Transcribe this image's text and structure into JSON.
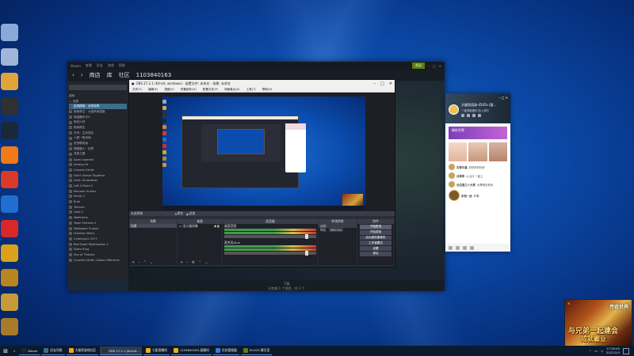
{
  "desktop": {
    "icons": [
      {
        "name": "recycle-bin-icon",
        "color": "#8aa9d8"
      },
      {
        "name": "this-pc-icon",
        "color": "#9fb6d8"
      },
      {
        "name": "chrome-icon",
        "color": "#e0a43a"
      },
      {
        "name": "obs-icon",
        "color": "#303030"
      },
      {
        "name": "steam-icon",
        "color": "#1b2838"
      },
      {
        "name": "app-orange-icon",
        "color": "#f07a1a"
      },
      {
        "name": "app-red-icon",
        "color": "#d93a2a"
      },
      {
        "name": "app-blue-icon",
        "color": "#1f6fd1"
      },
      {
        "name": "netease-music-icon",
        "color": "#d82828"
      },
      {
        "name": "app-yellow-icon",
        "color": "#d9a21a"
      },
      {
        "name": "game-app-icon",
        "color": "#b8861c"
      },
      {
        "name": "game-app-2-icon",
        "color": "#c79a3a"
      },
      {
        "name": "game-app-3-icon",
        "color": "#a87a2a"
      }
    ]
  },
  "steam": {
    "top_menu": [
      "Steam",
      "查看",
      "好友",
      "游戏",
      "帮助"
    ],
    "top_right_btn": "邀请",
    "nav": [
      "商店",
      "库",
      "社区"
    ],
    "user_id": "1103840163",
    "sidebar_header": "游戏",
    "sidebar_section": "— 全部",
    "sidebar_items": [
      "反恐精英：全球攻势",
      "绝地求生：大逃杀竞技版",
      "侠盗猎车手V",
      "彩虹六号",
      "绝地求生",
      "方舟：生存进化",
      "人类一败涂地",
      "饥荒联机版",
      "怪物猎人：世界",
      "流放之路",
      "Apex Legends",
      "Among Us",
      "Counter-Strike",
      "Don't Starve Together",
      "Hunt: Showdown",
      "Left 4 Dead 2",
      "Monster Hunter",
      "Portal 2",
      "Rust",
      "Terraria",
      "Dota 2",
      "Warframe",
      "Team Fortress 2",
      "Wallpaper Engine",
      "Stardew Valley",
      "Cyberpunk 2077",
      "Red Dead Redemption 2",
      "Elden Ring",
      "Sea of Thieves",
      "Counter-Strike: Global Offensive"
    ],
    "bottom_label": "下载",
    "bottom_sub": "已完成 1 个项目，共 1 个"
  },
  "obs": {
    "title": "OBS 27.2.1 (64-bit, windows) - 配置文件: 未命名 - 场景: 未命名",
    "menu": [
      "文件(F)",
      "编辑(E)",
      "视图(V)",
      "停靠部件(D)",
      "配置文件(P)",
      "场景集合(S)",
      "工具(T)",
      "帮助(H)"
    ],
    "no_source_label": "未选择源",
    "props_label": "属性",
    "filters_label": "滤镜",
    "docks": {
      "scenes": "场景",
      "sources": "来源",
      "mixer": "混音器",
      "transitions": "转场特效",
      "controls": "控件"
    },
    "scene_item": "场景",
    "source_item": "显示器采集",
    "mixer_tracks": [
      "桌面音频",
      "麦克风/Aux"
    ],
    "transition_type": "淡出",
    "transition_duration_label": "时长",
    "transition_duration": "300 ms",
    "controls": [
      "开始推流",
      "开始录制",
      "启动虚拟摄像机",
      "工作室模式",
      "设置",
      "退出"
    ]
  },
  "qq": {
    "title": "大猫哥语录-4545s (客...",
    "subtitle": "一键领取福利 加入我们",
    "banner": "精彩世界",
    "messages": [
      {
        "user": "杰哥牛逼",
        "text": "好好好好好好"
      },
      {
        "user": "兵哥哥",
        "text": "火山口 一起上"
      },
      {
        "user": "云边第三人大哥",
        "text": "大哥明天来玩"
      },
      {
        "user": "永恒一战",
        "text": "好嘞"
      }
    ]
  },
  "game_ad": {
    "logo": "传奇世界",
    "line1": "与兄弟一起建会",
    "line2": "成就霸业",
    "close": "×"
  },
  "taskbar": {
    "items": [
      {
        "label": "Steam",
        "color": "#1b2838",
        "active": false
      },
      {
        "label": "好友列表",
        "color": "#3d6c8d",
        "active": false
      },
      {
        "label": "大猫哥游戏社区",
        "color": "#f2a51a",
        "active": false
      },
      {
        "label": "OBS 27.2.1 (64-bit...",
        "color": "#303030",
        "active": true
      },
      {
        "label": "七星直播间",
        "color": "#e5b21a",
        "active": false
      },
      {
        "label": "1103840163-直播间",
        "color": "#e5b21a",
        "active": false
      },
      {
        "label": "任务管理器",
        "color": "#3a7bd5",
        "active": false
      },
      {
        "label": "ZLOGS 聊天室",
        "color": "#5c7e10",
        "active": false
      }
    ],
    "time": "17:26:45",
    "date": "2022/2/4"
  }
}
